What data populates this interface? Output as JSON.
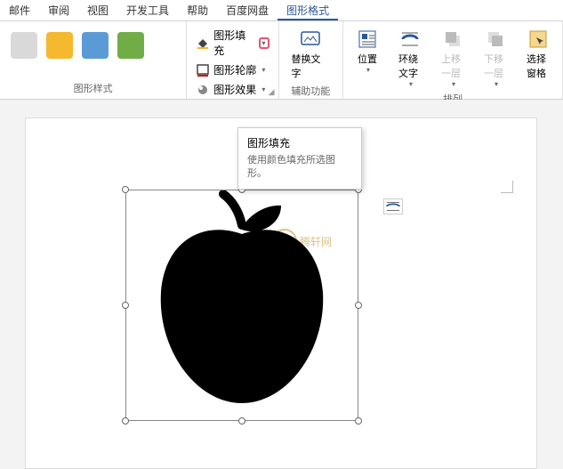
{
  "tabs": {
    "mail": "邮件",
    "review": "审阅",
    "view": "视图",
    "dev": "开发工具",
    "help": "帮助",
    "baidu": "百度网盘",
    "shape_format": "图形格式"
  },
  "ribbon": {
    "styles_label": "图形样式",
    "fill": "图形填充",
    "outline": "图形轮廓",
    "effects": "图形效果",
    "alt_text": "替换文字",
    "alt_text_sub": "",
    "aux_label": "辅助功能",
    "position": "位置",
    "wrap": "环绕文字",
    "bring_forward": "上移一层",
    "send_backward": "下移一层",
    "selection_pane": "选择窗格",
    "arrange_label": "排列"
  },
  "tooltip": {
    "title": "图形填充",
    "body": "使用颜色填充所选图形。"
  },
  "watermark": {
    "text": "腾轩网"
  },
  "colors": {
    "accent": "#2b579a"
  }
}
